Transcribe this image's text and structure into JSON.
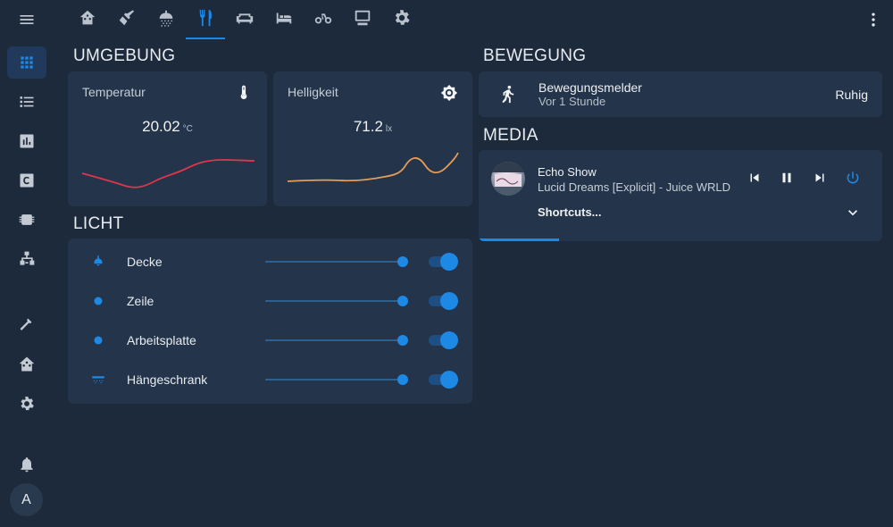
{
  "sidebar": {
    "items": [
      {
        "name": "menu-icon",
        "active": false
      },
      {
        "name": "overview-icon",
        "active": true
      },
      {
        "name": "logbook-icon",
        "active": false
      },
      {
        "name": "history-icon",
        "active": false
      },
      {
        "name": "c-icon",
        "active": false
      },
      {
        "name": "chip-icon",
        "active": false
      },
      {
        "name": "sitemap-icon",
        "active": false
      },
      {
        "name": "hammer-icon",
        "active": false
      },
      {
        "name": "home-assistant-icon",
        "active": false
      },
      {
        "name": "settings-icon",
        "active": false
      },
      {
        "name": "bell-icon",
        "active": false
      }
    ],
    "avatar_initial": "A"
  },
  "topbar": {
    "tabs": [
      "home",
      "cleaning",
      "shower",
      "kitchen",
      "living-room",
      "bedroom",
      "bike",
      "computer",
      "settings"
    ],
    "active_tab": "kitchen"
  },
  "sections": {
    "environment": "UMGEBUNG",
    "light": "LICHT",
    "motion": "BEWEGUNG",
    "media": "MEDIA"
  },
  "sensors": {
    "temperature": {
      "label": "Temperatur",
      "value": "20.02",
      "unit": "°C",
      "icon": "thermometer-icon",
      "line_color": "#e2344c"
    },
    "brightness": {
      "label": "Helligkeit",
      "value": "71.2",
      "unit": "lx",
      "icon": "brightness-icon",
      "line_color": "#e39d58"
    }
  },
  "lights": [
    {
      "name": "Decke",
      "icon": "ceiling-lamp-icon",
      "level": 0.98,
      "on": true
    },
    {
      "name": "Zeile",
      "icon": "bulb-icon",
      "level": 0.98,
      "on": true
    },
    {
      "name": "Arbeitsplatte",
      "icon": "bulb-icon",
      "level": 0.98,
      "on": true
    },
    {
      "name": "Hängeschrank",
      "icon": "cabinet-light-icon",
      "level": 0.98,
      "on": true
    }
  ],
  "motion": {
    "name": "Bewegungsmelder",
    "time": "Vor 1 Stunde",
    "state": "Ruhig",
    "icon": "walk-icon"
  },
  "media": {
    "device": "Echo Show",
    "track": "Lucid Dreams [Explicit] - Juice WRLD",
    "shortcuts": "Shortcuts...",
    "progress": 0.2,
    "accent": "#1e88e5"
  },
  "colors": {
    "background": "#1c2a3c",
    "card": "#24344a",
    "accent": "#1e88e5"
  }
}
